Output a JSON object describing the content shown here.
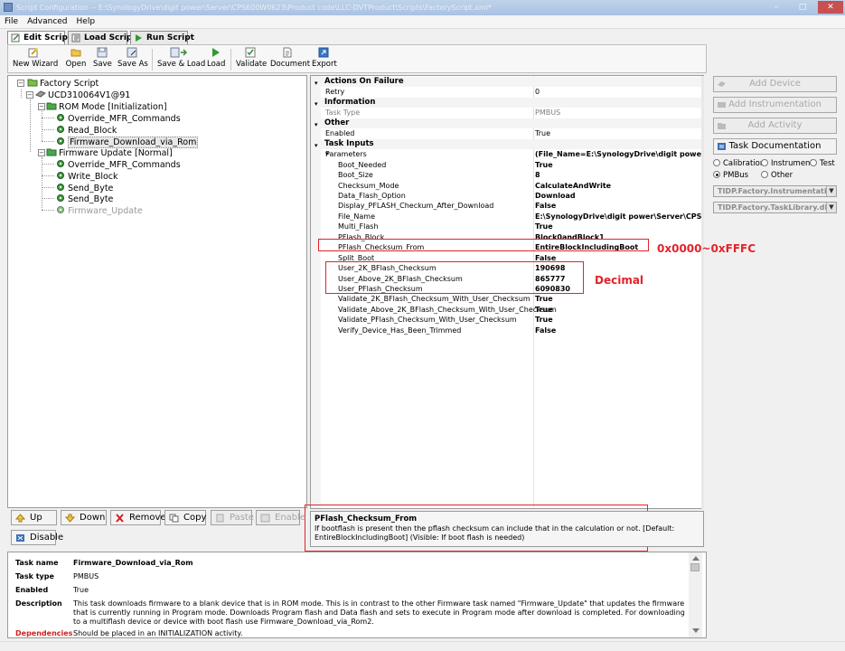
{
  "window": {
    "title": "Script Configuration -- E:\\SynologyDrive\\digit power\\Server\\CPS600W0623\\Product code\\LLC-DVTProduct\\Scripts\\FactoryScript.xml*"
  },
  "menu": [
    "File",
    "Advanced",
    "Help"
  ],
  "tabs": [
    "Edit Script",
    "Load Script",
    "Run Script"
  ],
  "toolbar": [
    "New Wizard",
    "Open",
    "Save",
    "Save As",
    "Save & Load",
    "Load",
    "Validate",
    "Document",
    "Export"
  ],
  "tree": {
    "root": "Factory Script",
    "device": "UCD310064V1@91",
    "rom_mode": "ROM Mode [Initialization]",
    "rom_tasks": [
      "Override_MFR_Commands",
      "Read_Block",
      "Firmware_Download_via_Rom"
    ],
    "fw_update": "Firmware Update [Normal]",
    "fw_tasks": [
      "Override_MFR_Commands",
      "Write_Block",
      "Send_Byte",
      "Send_Byte",
      "Firmware_Update"
    ]
  },
  "properties": [
    {
      "kind": "cat",
      "name": "Actions On Failure"
    },
    {
      "kind": "prop",
      "name": "Retry",
      "value": "0",
      "style": "plain"
    },
    {
      "kind": "cat",
      "name": "Information"
    },
    {
      "kind": "prop",
      "name": "Task Type",
      "value": "PMBUS",
      "style": "disabled"
    },
    {
      "kind": "cat",
      "name": "Other"
    },
    {
      "kind": "prop",
      "name": "Enabled",
      "value": "True",
      "style": "plain"
    },
    {
      "kind": "cat",
      "name": "Task Inputs"
    },
    {
      "kind": "group",
      "name": "Parameters",
      "value": "(File_Name=E:\\SynologyDrive\\digit power\\Server\\CPS550W"
    },
    {
      "kind": "sub",
      "name": "Boot_Needed",
      "value": "True"
    },
    {
      "kind": "sub",
      "name": "Boot_Size",
      "value": "8"
    },
    {
      "kind": "sub",
      "name": "Checksum_Mode",
      "value": "CalculateAndWrite"
    },
    {
      "kind": "sub",
      "name": "Data_Flash_Option",
      "value": "Download"
    },
    {
      "kind": "sub",
      "name": "Display_PFLASH_Checkum_After_Download",
      "value": "False"
    },
    {
      "kind": "sub",
      "name": "File_Name",
      "value": "E:\\SynologyDrive\\digit power\\Server\\CPS550W"
    },
    {
      "kind": "sub",
      "name": "Multi_Flash",
      "value": "True"
    },
    {
      "kind": "sub",
      "name": "PFlash_Block",
      "value": "Block0andBlock1"
    },
    {
      "kind": "sub",
      "name": "PFlash_Checksum_From",
      "value": "EntireBlockIncludingBoot"
    },
    {
      "kind": "sub",
      "name": "Split_Boot",
      "value": "False"
    },
    {
      "kind": "sub",
      "name": "User_2K_BFlash_Checksum",
      "value": "190698"
    },
    {
      "kind": "sub",
      "name": "User_Above_2K_BFlash_Checksum",
      "value": "865777"
    },
    {
      "kind": "sub",
      "name": "User_PFlash_Checksum",
      "value": "6090830"
    },
    {
      "kind": "sub",
      "name": "Validate_2K_BFlash_Checksum_With_User_Checksum",
      "value": "True"
    },
    {
      "kind": "sub",
      "name": "Validate_Above_2K_BFlash_Checksum_With_User_Checksum",
      "value": "True"
    },
    {
      "kind": "sub",
      "name": "Validate_PFlash_Checksum_With_User_Checksum",
      "value": "True"
    },
    {
      "kind": "sub",
      "name": "Verify_Device_Has_Been_Trimmed",
      "value": "False"
    }
  ],
  "annotations": {
    "range": "0x0000~0xFFFC",
    "decimal": "Decimal"
  },
  "description": {
    "title": "PFlash_Checksum_From",
    "text": "If bootflash is present then the pflash checksum can include that in the calculation or not. [Default: EntireBlockIncludingBoot] (Visible: If boot flash is needed)"
  },
  "right_panel": {
    "add_device": "Add Device",
    "add_instrumentation": "Add Instrumentation",
    "add_activity": "Add Activity",
    "task_doc": "Task Documentation",
    "radios": [
      "Calibration",
      "Instrument",
      "Test",
      "PMBus",
      "Other"
    ],
    "selected_radio": "PMBus",
    "lib1": "TIDP.Factory.Instrumentation",
    "lib2": "TIDP.Factory.TaskLibrary.dll"
  },
  "buttons": [
    "Up",
    "Down",
    "Remove",
    "Copy",
    "Paste",
    "Enable",
    "Disable"
  ],
  "bottom": {
    "task_name_label": "Task name",
    "task_name": "Firmware_Download_via_Rom",
    "task_type_label": "Task type",
    "task_type": "PMBUS",
    "enabled_label": "Enabled",
    "enabled": "True",
    "description_label": "Description",
    "description": "This task downloads firmware to a blank device that is in ROM mode. This is in contrast to the other Firmware task named \"Firmware_Update\" that updates the firmware that is currently running in Program mode. Downloads Program flash and Data flash and sets to execute in Program mode after download is completed. For downloading to a multiflash device or device with boot flash use Firmware_Download_via_Rom2.",
    "dependencies_label": "Dependencies",
    "dependencies": "Should be placed in an INITIALIZATION activity."
  },
  "colors": {
    "accent_red": "#e0242b",
    "title_bar": "#a9c2e2",
    "tree_green": "#2f8a2f"
  }
}
